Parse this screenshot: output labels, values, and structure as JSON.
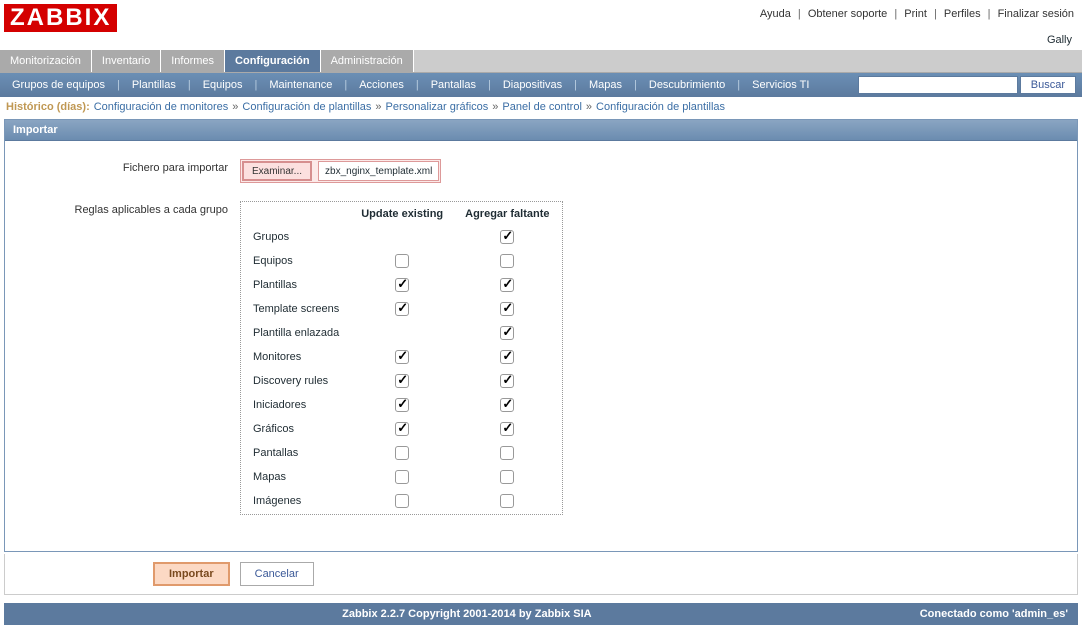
{
  "logo": "ZABBIX",
  "top_links": {
    "help": "Ayuda",
    "support": "Obtener soporte",
    "print": "Print",
    "profile": "Perfiles",
    "logout": "Finalizar sesión"
  },
  "username": "Gally",
  "main_tabs": {
    "monitoring": "Monitorización",
    "inventory": "Inventario",
    "reports": "Informes",
    "configuration": "Configuración",
    "administration": "Administración"
  },
  "sub_tabs": {
    "hostgroups": "Grupos de equipos",
    "templates": "Plantillas",
    "hosts": "Equipos",
    "maintenance": "Maintenance",
    "actions": "Acciones",
    "screens": "Pantallas",
    "slides": "Diapositivas",
    "maps": "Mapas",
    "discovery": "Descubrimiento",
    "it": "Servicios TI",
    "search": "Buscar"
  },
  "breadcrumb": {
    "history": "Histórico (días):",
    "b1": "Configuración de monitores",
    "b2": "Configuración de plantillas",
    "b3": "Personalizar gráficos",
    "b4": "Panel de control",
    "b5": "Configuración de plantillas"
  },
  "panel_title": "Importar",
  "form": {
    "file_label": "Fichero para importar",
    "browse": "Examinar...",
    "filename": "zbx_nginx_template.xml",
    "rules_label": "Reglas aplicables a cada grupo",
    "col_update": "Update existing",
    "col_add": "Agregar faltante",
    "rows": [
      {
        "label": "Grupos",
        "update": null,
        "add": true
      },
      {
        "label": "Equipos",
        "update": false,
        "add": false
      },
      {
        "label": "Plantillas",
        "update": true,
        "add": true
      },
      {
        "label": "Template screens",
        "update": true,
        "add": true
      },
      {
        "label": "Plantilla enlazada",
        "update": null,
        "add": true
      },
      {
        "label": "Monitores",
        "update": true,
        "add": true
      },
      {
        "label": "Discovery rules",
        "update": true,
        "add": true
      },
      {
        "label": "Iniciadores",
        "update": true,
        "add": true
      },
      {
        "label": "Gráficos",
        "update": true,
        "add": true
      },
      {
        "label": "Pantallas",
        "update": false,
        "add": false
      },
      {
        "label": "Mapas",
        "update": false,
        "add": false
      },
      {
        "label": "Imágenes",
        "update": false,
        "add": false
      }
    ]
  },
  "actions": {
    "import": "Importar",
    "cancel": "Cancelar"
  },
  "footer": {
    "left": "Zabbix 2.2.7 Copyright 2001-2014 by Zabbix SIA",
    "right": "Conectado como 'admin_es'"
  }
}
